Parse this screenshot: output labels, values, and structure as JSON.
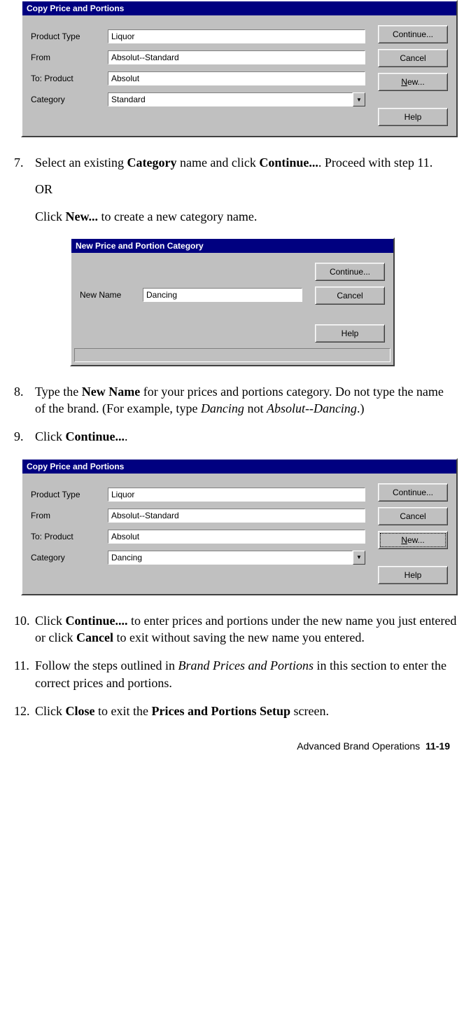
{
  "dialog1": {
    "title": "Copy Price and Portions",
    "labels": {
      "productType": "Product Type",
      "from": "From",
      "toProduct": "To:  Product",
      "category": "Category"
    },
    "values": {
      "productType": "Liquor",
      "from": "Absolut--Standard",
      "toProduct": "Absolut",
      "category": "Standard"
    },
    "buttons": {
      "continue": "Continue...",
      "cancel": "Cancel",
      "newPrefix": "N",
      "newSuffix": "ew...",
      "help": "Help"
    }
  },
  "step7": {
    "num": "7.",
    "line1_a": "Select an existing ",
    "line1_b": "Category",
    "line1_c": " name and click ",
    "line1_d": "Continue...",
    "line1_e": ". Proceed with step 11.",
    "or": "OR",
    "line2_a": "Click ",
    "line2_b": "New...",
    "line2_c": " to create a new category name."
  },
  "dialog2": {
    "title": "New Price and Portion Category",
    "label": "New Name",
    "value": "Dancing",
    "buttons": {
      "continue": "Continue...",
      "cancel": "Cancel",
      "help": "Help"
    }
  },
  "step8": {
    "num": "8.",
    "a": "Type the ",
    "b": "New Name",
    "c": " for your prices and portions category. Do not type the name of the brand. (For example, type ",
    "d": "Dancing",
    "e": " not ",
    "f": "Absolut--Dancing",
    "g": ".)"
  },
  "step9": {
    "num": "9.",
    "a": "Click ",
    "b": "Continue...",
    "c": "."
  },
  "dialog3": {
    "title": "Copy Price and Portions",
    "labels": {
      "productType": "Product Type",
      "from": "From",
      "toProduct": "To:  Product",
      "category": "Category"
    },
    "values": {
      "productType": "Liquor",
      "from": "Absolut--Standard",
      "toProduct": "Absolut",
      "category": "Dancing"
    },
    "buttons": {
      "continue": "Continue...",
      "cancel": "Cancel",
      "newPrefix": "N",
      "newSuffix": "ew...",
      "help": "Help"
    }
  },
  "step10": {
    "num": "10.",
    "a": "Click ",
    "b": "Continue....",
    "c": " to enter prices and portions under the new name you just entered or click ",
    "d": "Cancel",
    "e": " to exit without saving the new name you entered."
  },
  "step11": {
    "num": "11.",
    "a": "Follow the steps outlined in ",
    "b": "Brand Prices and Portions",
    "c": " in this section to enter the correct prices and portions."
  },
  "step12": {
    "num": "12.",
    "a": "Click ",
    "b": "Close",
    "c": " to exit the ",
    "d": "Prices and Portions Setup",
    "e": " screen."
  },
  "footer": {
    "section": "Advanced Brand Operations",
    "page": "11-19"
  }
}
